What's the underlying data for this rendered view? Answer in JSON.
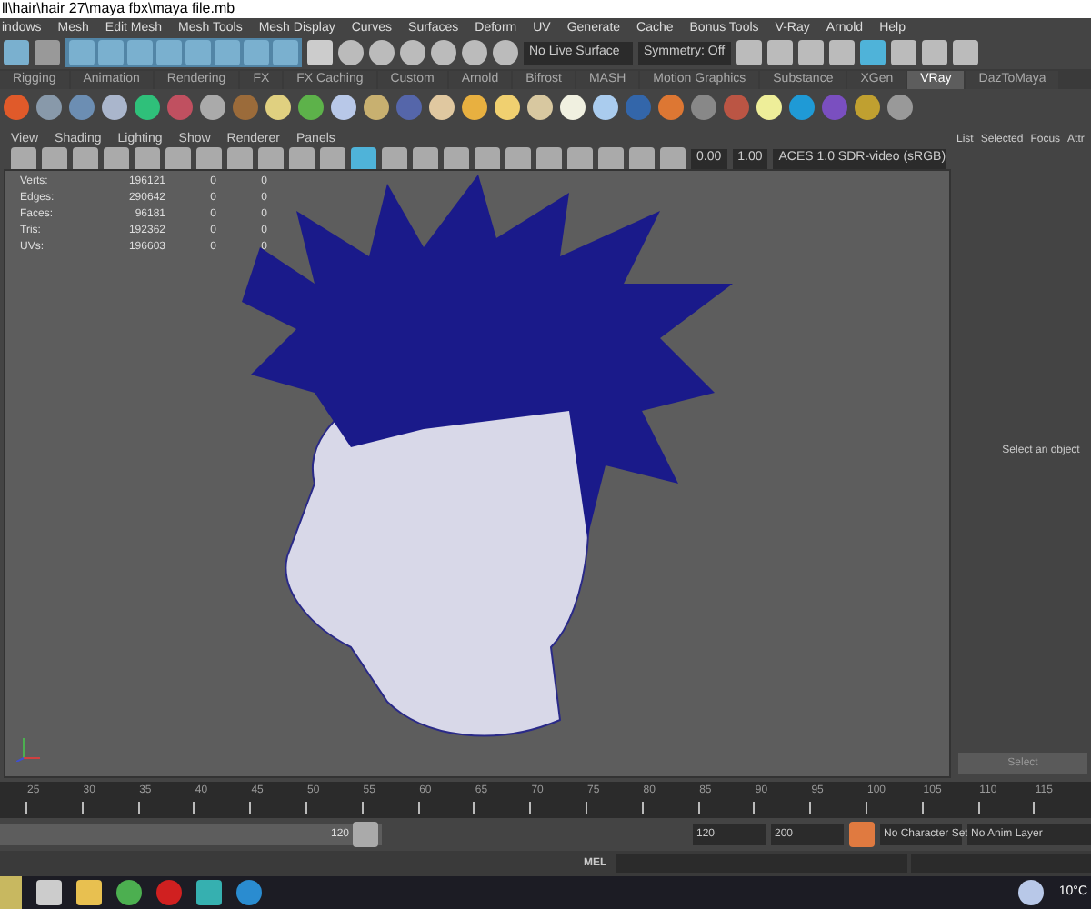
{
  "window": {
    "title": "ll\\hair\\hair 27\\maya fbx\\maya file.mb"
  },
  "menu_bar": [
    "indows",
    "Mesh",
    "Edit Mesh",
    "Mesh Tools",
    "Mesh Display",
    "Curves",
    "Surfaces",
    "Deform",
    "UV",
    "Generate",
    "Cache",
    "Bonus Tools",
    "V-Ray",
    "Arnold",
    "Help"
  ],
  "status_line": {
    "live_surface": "No Live Surface",
    "symmetry": "Symmetry: Off"
  },
  "shelf_tabs": [
    {
      "label": "Rigging",
      "selected": false
    },
    {
      "label": "Animation",
      "selected": false
    },
    {
      "label": "Rendering",
      "selected": false
    },
    {
      "label": "FX",
      "selected": false
    },
    {
      "label": "FX Caching",
      "selected": false
    },
    {
      "label": "Custom",
      "selected": false
    },
    {
      "label": "Arnold",
      "selected": false
    },
    {
      "label": "Bifrost",
      "selected": false
    },
    {
      "label": "MASH",
      "selected": false
    },
    {
      "label": "Motion Graphics",
      "selected": false
    },
    {
      "label": "Substance",
      "selected": false
    },
    {
      "label": "XGen",
      "selected": false
    },
    {
      "label": "VRay",
      "selected": true
    },
    {
      "label": "DazToMaya",
      "selected": false
    }
  ],
  "viewport": {
    "menu": [
      "View",
      "Shading",
      "Lighting",
      "Show",
      "Renderer",
      "Panels"
    ],
    "exposure": "0.00",
    "gamma": "1.00",
    "color_space": "ACES 1.0 SDR-video (sRGB)",
    "stats": [
      {
        "label": "Verts:",
        "values": [
          "196121",
          "0",
          "0"
        ]
      },
      {
        "label": "Edges:",
        "values": [
          "290642",
          "0",
          "0"
        ]
      },
      {
        "label": "Faces:",
        "values": [
          "96181",
          "0",
          "0"
        ]
      },
      {
        "label": "Tris:",
        "values": [
          "192362",
          "0",
          "0"
        ]
      },
      {
        "label": "UVs:",
        "values": [
          "196603",
          "0",
          "0"
        ]
      }
    ]
  },
  "attribute_panel": {
    "tabs": [
      "List",
      "Selected",
      "Focus",
      "Attr"
    ],
    "message": "Select an object",
    "button": "Select"
  },
  "time_slider": {
    "ticks": [
      "25",
      "30",
      "35",
      "40",
      "45",
      "50",
      "55",
      "60",
      "65",
      "70",
      "75",
      "80",
      "85",
      "90",
      "95",
      "100",
      "105",
      "110",
      "115"
    ]
  },
  "range_slider": {
    "end": "120",
    "end_field": "120",
    "max_field": "200",
    "character_set": "No Character Set",
    "anim_layer": "No Anim Layer"
  },
  "command_line": {
    "language": "MEL"
  },
  "taskbar": {
    "weather": "10°C"
  }
}
